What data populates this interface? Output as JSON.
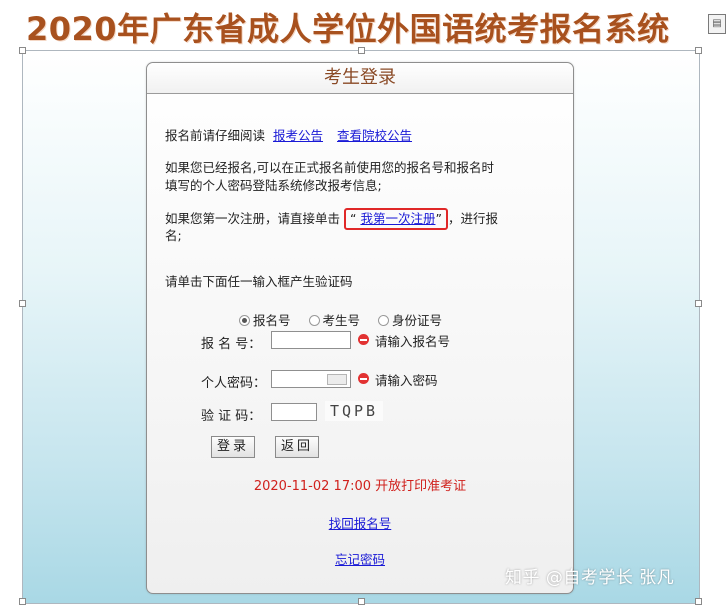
{
  "page": {
    "title": "2020年广东省成人学位外国语统考报名系统"
  },
  "login": {
    "header": "考生登录",
    "read_prefix": "报名前请仔细阅读",
    "link_exam_notice": "报考公告",
    "link_school_notice": "查看院校公告",
    "already_registered_line1": "如果您已经报名,可以在正式报名前使用您的报名号和报名时",
    "already_registered_line2": "填写的个人密码登陆系统修改报考信息;",
    "first_time_prefix": "如果您第一次注册，请直接单击",
    "first_time_link": "我第一次注册",
    "first_time_suffix": "，进行报",
    "first_time_line2": "名;",
    "instruction": "请单击下面任一输入框产生验证码",
    "radio_options": [
      "报名号",
      "考生号",
      "身份证号"
    ],
    "radio_selected": "报名号",
    "label_reg_no": "报 名 号：",
    "label_password": "个人密码：",
    "label_captcha": "验 证 码：",
    "err_reg_no": "请输入报名号",
    "err_password": "请输入密码",
    "captcha_text": "TQPB",
    "btn_login": "登录",
    "btn_back": "返回",
    "notice": "2020-11-02 17:00 开放打印准考证",
    "link_find_reg_no": "找回报名号",
    "link_forgot_password": "忘记密码"
  },
  "watermark": "知乎 @自考学长 张凡"
}
